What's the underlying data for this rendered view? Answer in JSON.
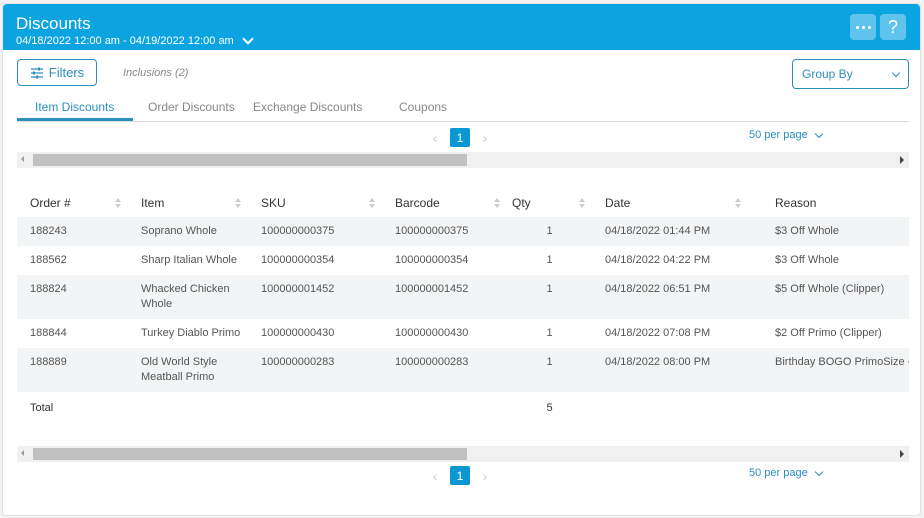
{
  "header": {
    "title": "Discounts",
    "date_range": "04/18/2022 12:00 am - 04/19/2022 12:00 am",
    "more_icon": "ellipsis-icon",
    "help_label": "?"
  },
  "toolbar": {
    "filters_label": "Filters",
    "inclusions_label": "Inclusions (2)",
    "group_by_label": "Group By"
  },
  "tabs": [
    {
      "label": "Item Discounts",
      "active": true
    },
    {
      "label": "Order Discounts",
      "active": false
    },
    {
      "label": "Exchange Discounts",
      "active": false
    },
    {
      "label": "Coupons",
      "active": false
    }
  ],
  "pagination": {
    "current_page": "1",
    "per_page_label": "50 per page",
    "prev_glyph": "‹",
    "next_glyph": "›"
  },
  "table": {
    "columns": [
      "Order #",
      "Item",
      "SKU",
      "Barcode",
      "Qty",
      "Date",
      "Reason"
    ],
    "rows": [
      {
        "order": "188243",
        "item": "Soprano Whole",
        "sku": "100000000375",
        "barcode": "100000000375",
        "qty": "1",
        "date": "04/18/2022 01:44 PM",
        "reason": "$3 Off Whole"
      },
      {
        "order": "188562",
        "item": "Sharp Italian Whole",
        "sku": "100000000354",
        "barcode": "100000000354",
        "qty": "1",
        "date": "04/18/2022 04:22 PM",
        "reason": "$3 Off Whole"
      },
      {
        "order": "188824",
        "item": "Whacked Chicken Whole",
        "sku": "100000001452",
        "barcode": "100000001452",
        "qty": "1",
        "date": "04/18/2022 06:51 PM",
        "reason": "$5 Off Whole (Clipper)"
      },
      {
        "order": "188844",
        "item": "Turkey Diablo Primo",
        "sku": "100000000430",
        "barcode": "100000000430",
        "qty": "1",
        "date": "04/18/2022 07:08 PM",
        "reason": "$2 Off Primo (Clipper)"
      },
      {
        "order": "188889",
        "item": "Old World Style Meatball Primo",
        "sku": "100000000283",
        "barcode": "100000000283",
        "qty": "1",
        "date": "04/18/2022 08:00 PM",
        "reason": "Birthday BOGO PrimoSize -"
      }
    ],
    "total_label": "Total",
    "total_qty": "5"
  }
}
